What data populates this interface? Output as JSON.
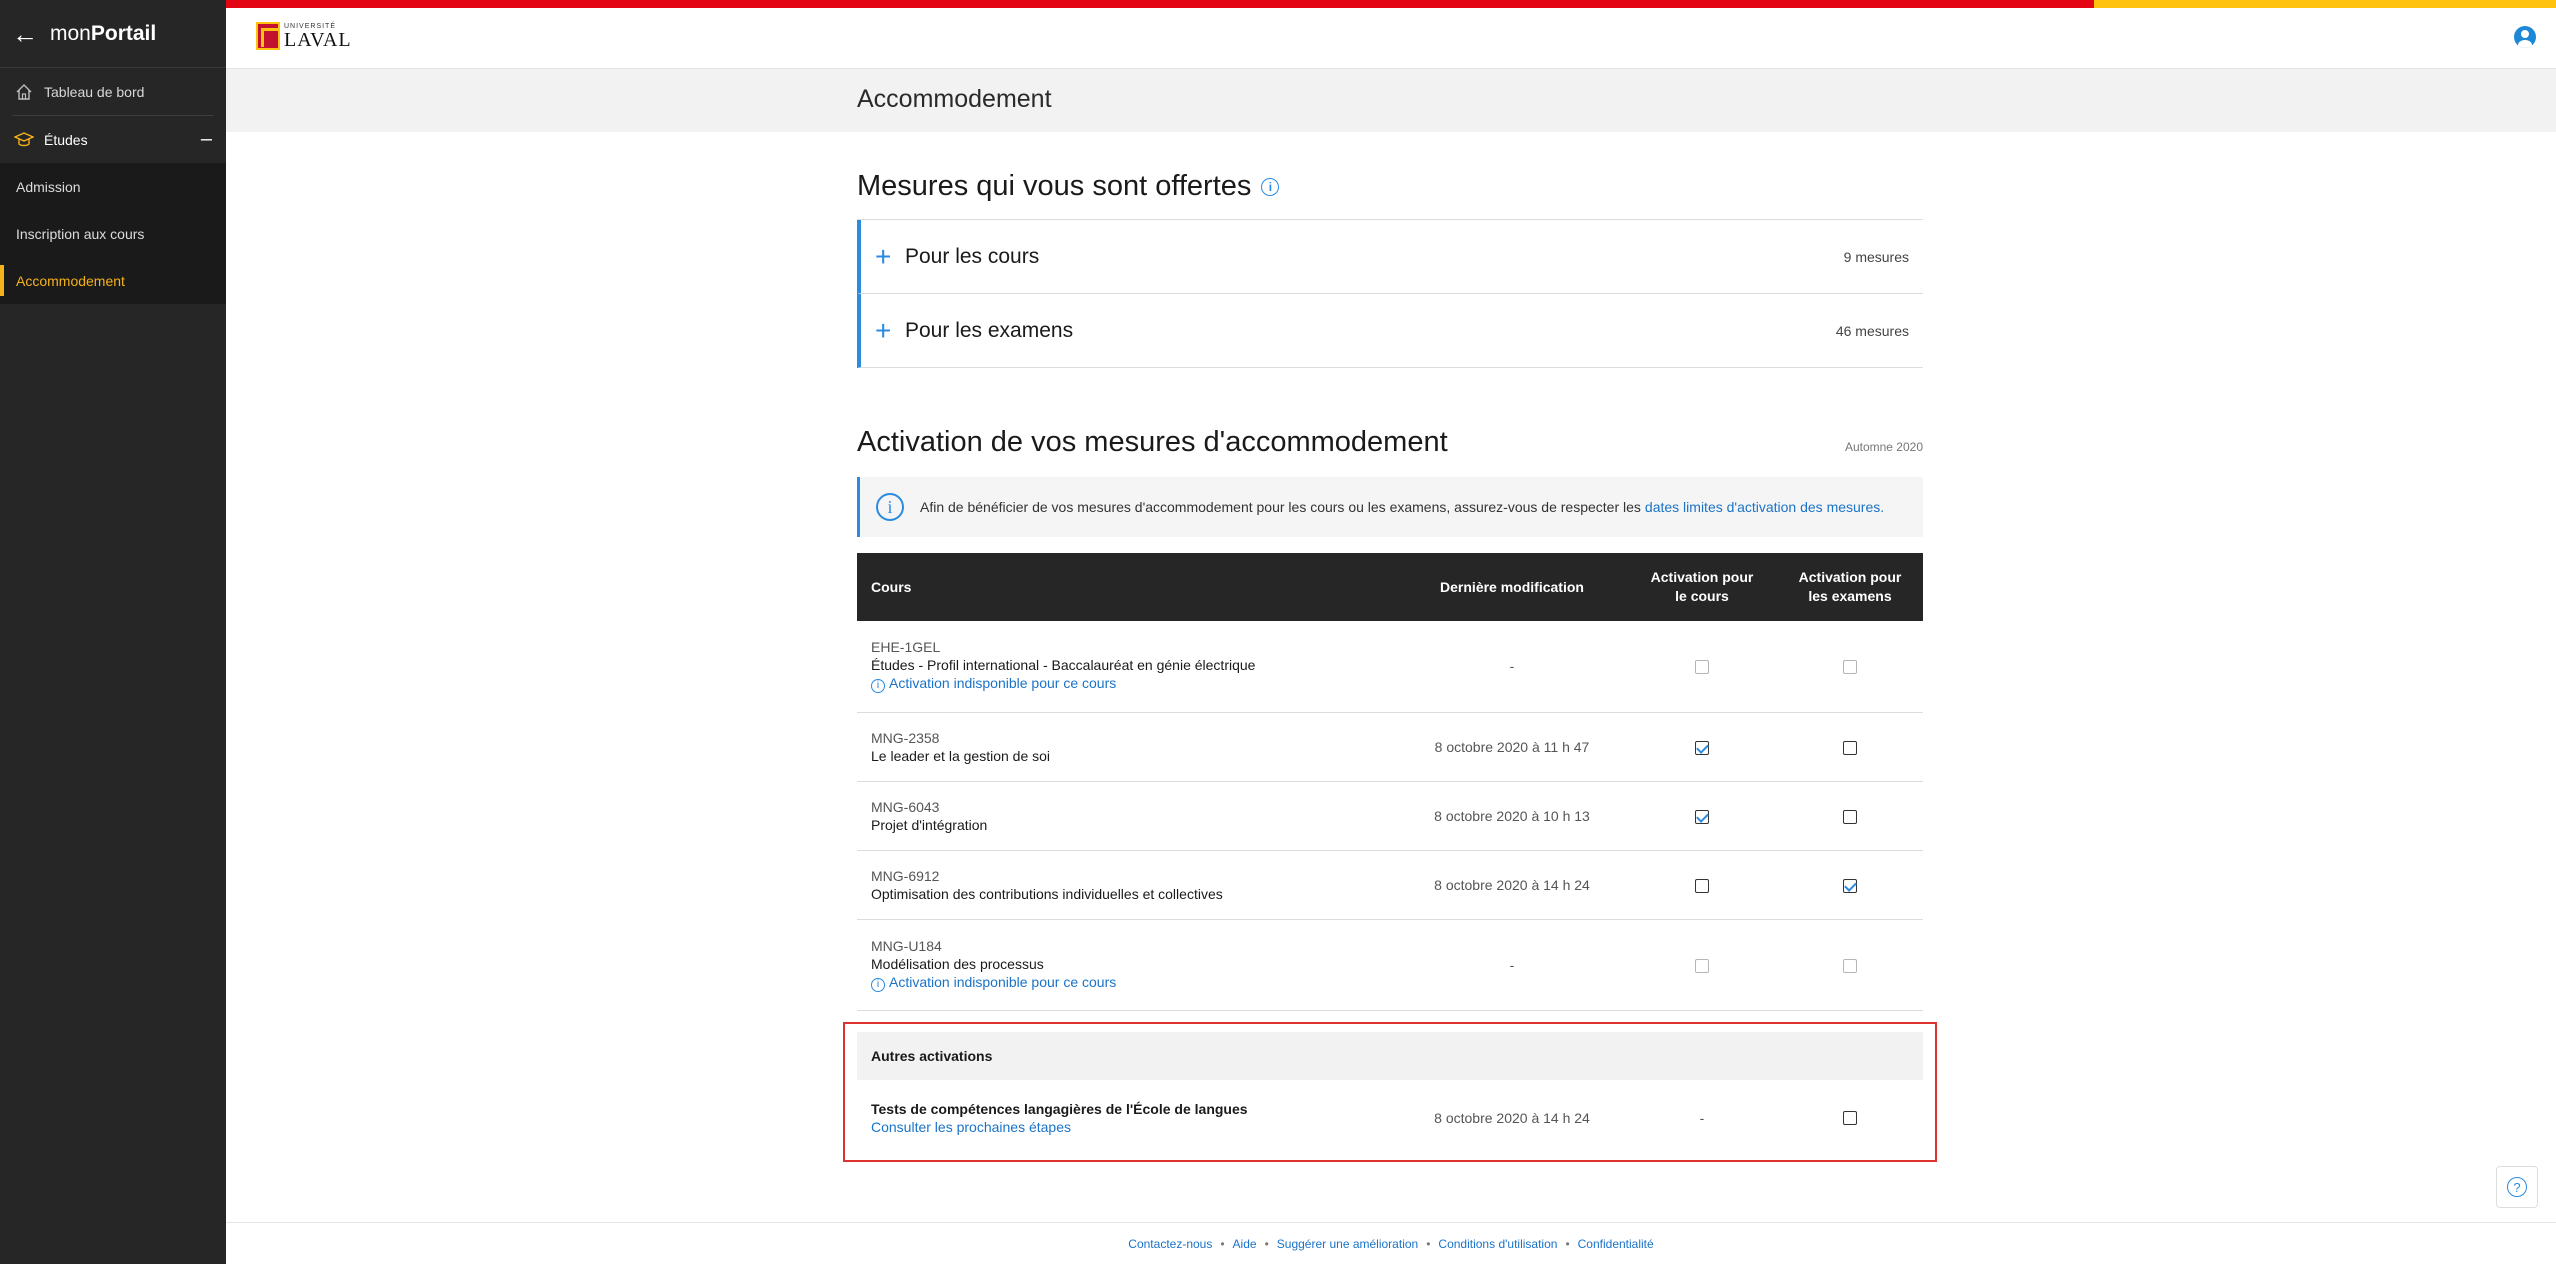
{
  "app": {
    "title_prefix": "mon",
    "title_bold": "Portail"
  },
  "sidebar": {
    "dashboard": "Tableau de bord",
    "studies": "Études",
    "collapse": "–",
    "subitems": [
      "Admission",
      "Inscription aux cours",
      "Accommodement"
    ]
  },
  "brand": {
    "small": "UNIVERSITÉ",
    "big": "LAVAL",
    "red": "#e30513",
    "yellow": "#ffc20e"
  },
  "page": {
    "title": "Accommodement"
  },
  "measures": {
    "title": "Mesures qui vous sont offertes",
    "info": "i",
    "items": [
      {
        "label": "Pour les cours",
        "count": "9 mesures"
      },
      {
        "label": "Pour les examens",
        "count": "46 mesures"
      }
    ]
  },
  "activation": {
    "title": "Activation de vos mesures d'accommodement",
    "term": "Automne 2020",
    "notice_text": "Afin de bénéficier de vos mesures d'accommodement pour les cours ou les examens, assurez-vous de respecter les",
    "notice_link": "dates limites d'activation des mesures.",
    "headers": {
      "course": "Cours",
      "modified": "Dernière modification",
      "act_courses_1": "Activation pour",
      "act_courses_2": "le cours",
      "act_exams_1": "Activation pour",
      "act_exams_2": "les examens"
    },
    "unavailable": "Activation indisponible pour ce cours",
    "rows": [
      {
        "code": "EHE-1GEL",
        "name": "Études - Profil international - Baccalauréat en génie électrique",
        "date": "-"
      },
      {
        "code": "MNG-2358",
        "name": "Le leader et la gestion de soi",
        "date": "8 octobre 2020 à 11 h 47"
      },
      {
        "code": "MNG-6043",
        "name": "Projet d'intégration",
        "date": "8 octobre 2020 à 10 h 13"
      },
      {
        "code": "MNG-6912",
        "name": "Optimisation des contributions individuelles et collectives",
        "date": "8 octobre 2020 à 14 h 24"
      },
      {
        "code": "MNG-U184",
        "name": "Modélisation des processus",
        "date": "-"
      }
    ],
    "other": {
      "header": "Autres activations",
      "title": "Tests de compétences langagières de l'École de langues",
      "link": "Consulter les prochaines étapes",
      "date": "8 octobre 2020 à 14 h 24",
      "dash": "-"
    }
  },
  "footer": {
    "links": [
      "Contactez-nous",
      "Aide",
      "Suggérer une amélioration",
      "Conditions d'utilisation",
      "Confidentialité"
    ],
    "sep": "•"
  },
  "help": "?"
}
